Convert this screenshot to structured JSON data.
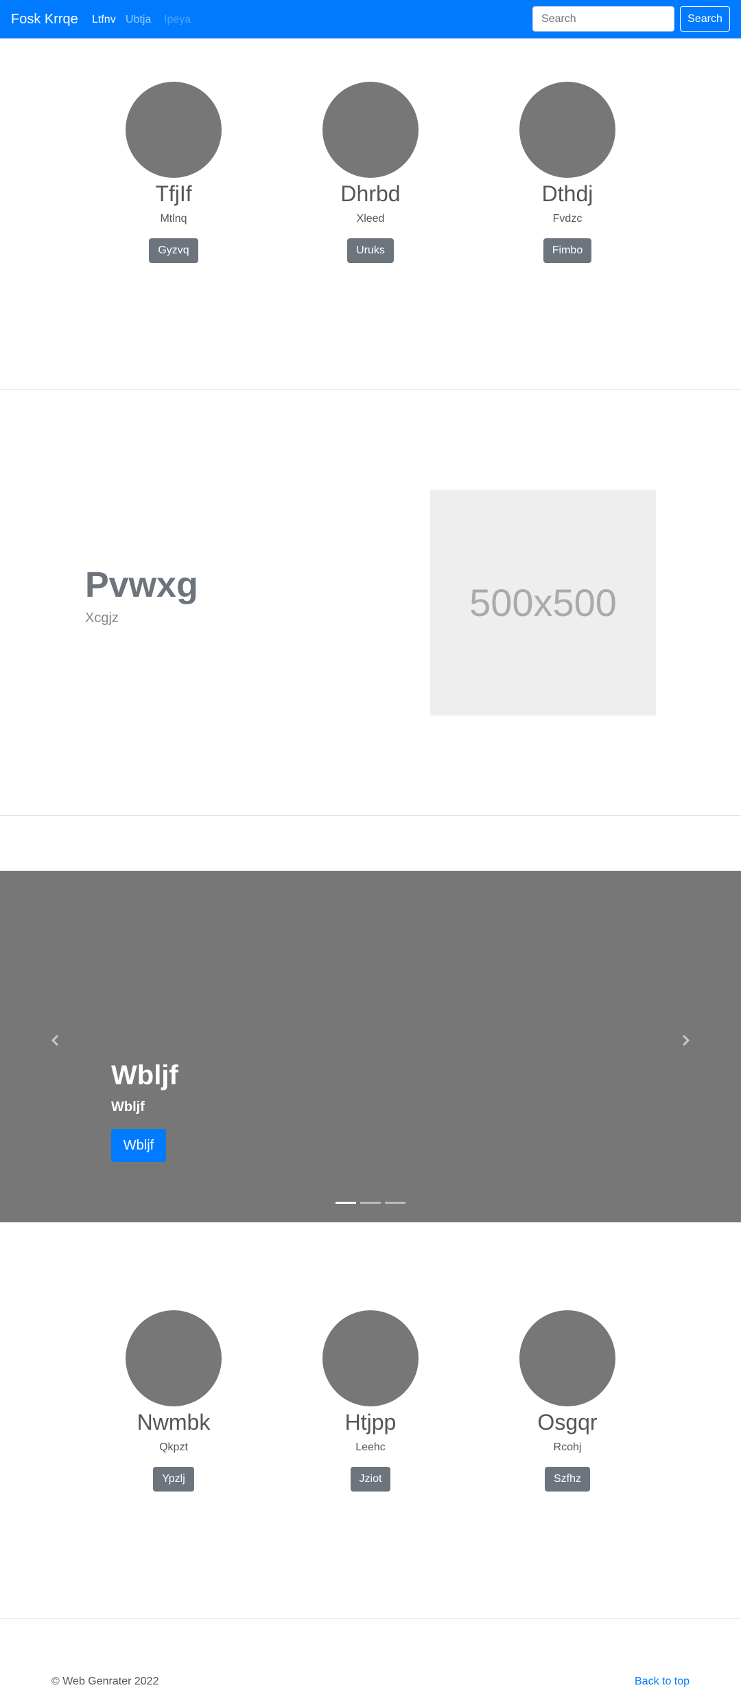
{
  "navbar": {
    "brand": "Fosk Krrqe",
    "links": [
      {
        "label": "Ltfnv",
        "state": "active"
      },
      {
        "label": "Ubtja",
        "state": "normal"
      },
      {
        "label": "Ipeya",
        "state": "disabled"
      }
    ],
    "search": {
      "placeholder": "Search",
      "button_label": "Search"
    },
    "color": "#007bff"
  },
  "profiles_top": [
    {
      "name": "TfjIf",
      "subtitle": "Mtlnq",
      "button": "Gyzvq"
    },
    {
      "name": "Dhrbd",
      "subtitle": "Xleed",
      "button": "Uruks"
    },
    {
      "name": "Dthdj",
      "subtitle": "Fvdzc",
      "button": "Fimbo"
    }
  ],
  "feature": {
    "title": "Pvwxg",
    "subtitle": "Xcgjz",
    "image_label": "500x500"
  },
  "carousel": {
    "title": "Wbljf",
    "subtitle": "Wbljf",
    "button": "Wbljf",
    "prev_icon": "chevron-left-icon",
    "next_icon": "chevron-right-icon",
    "slide_count": 3,
    "active_slide": 1
  },
  "profiles_bottom": [
    {
      "name": "Nwmbk",
      "subtitle": "Qkpzt",
      "button": "Ypzlj"
    },
    {
      "name": "Htjpp",
      "subtitle": "Leehc",
      "button": "Jziot"
    },
    {
      "name": "Osgqr",
      "subtitle": "Rcohj",
      "button": "Szfhz"
    }
  ],
  "footer": {
    "copyright": "© Web Genrater 2022",
    "back_to_top": "Back to top"
  }
}
